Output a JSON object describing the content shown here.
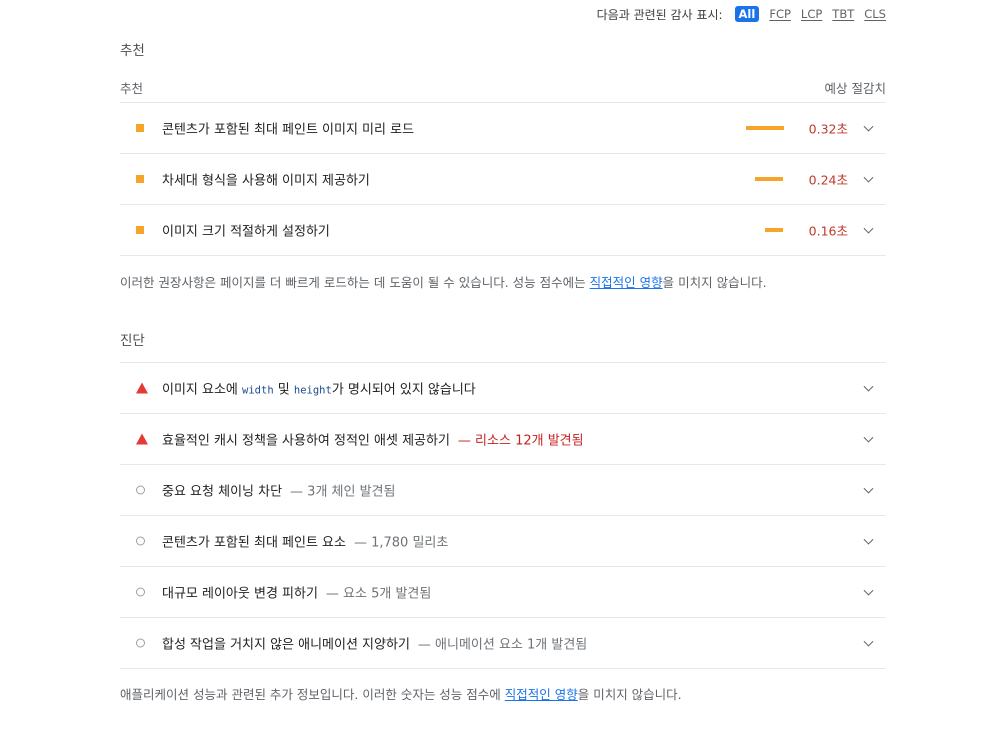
{
  "filter": {
    "label": "다음과 관련된 감사 표시:",
    "options": [
      "All",
      "FCP",
      "LCP",
      "TBT",
      "CLS"
    ],
    "active": "All",
    "active_color": "#1a73e8"
  },
  "opportunities": {
    "section_title": "추천",
    "col_left": "추천",
    "col_right": "예상 절감치",
    "items": [
      {
        "icon": "orange-square-icon",
        "title": "콘텐츠가 포함된 최대 페인트 이미지 미리 로드",
        "savings": "0.32초",
        "bar_value": 0.32
      },
      {
        "icon": "orange-square-icon",
        "title": "차세대 형식을 사용해 이미지 제공하기",
        "savings": "0.24초",
        "bar_value": 0.24
      },
      {
        "icon": "orange-square-icon",
        "title": "이미지 크기 적절하게 설정하기",
        "savings": "0.16초",
        "bar_value": 0.16
      }
    ],
    "note_before": "이러한 권장사항은 페이지를 더 빠르게 로드하는 데 도움이 될 수 있습니다. 성능 점수에는 ",
    "note_link": "직접적인 영향",
    "note_after": "을 미치지 않습니다."
  },
  "diagnostics": {
    "section_title": "진단",
    "items": [
      {
        "icon": "red-triangle-icon",
        "t1": "이미지 요소에 ",
        "code1": "width",
        "t2": " 및 ",
        "code2": "height",
        "t3": "가 명시되어 있지 않습니다",
        "sub": ""
      },
      {
        "icon": "red-triangle-icon",
        "t1": "효율적인 캐시 정책을 사용하여 정적인 애셋 제공하기",
        "sub": "— 리소스 12개 발견됨"
      },
      {
        "icon": "gray-circle-icon",
        "t1": "중요 요청 체이닝 차단",
        "sub": "— 3개 체인 발견됨"
      },
      {
        "icon": "gray-circle-icon",
        "t1": "콘텐츠가 포함된 최대 페인트 요소",
        "sub": "— 1,780 밀리초"
      },
      {
        "icon": "gray-circle-icon",
        "t1": "대규모 레이아웃 변경 피하기",
        "sub": "— 요소 5개 발견됨"
      },
      {
        "icon": "gray-circle-icon",
        "t1": "합성 작업을 거치지 않은 애니메이션 지양하기",
        "sub": "— 애니메이션 요소 1개 발견됨"
      }
    ],
    "note_before": "애플리케이션 성능과 관련된 추가 정보입니다. 이러한 숫자는 성능 점수에 ",
    "note_link": "직접적인 영향",
    "note_after": "을 미치지 않습니다."
  },
  "colors": {
    "warn": "#f6a52a",
    "fail": "#e53935",
    "savings_text": "#c0392b"
  }
}
